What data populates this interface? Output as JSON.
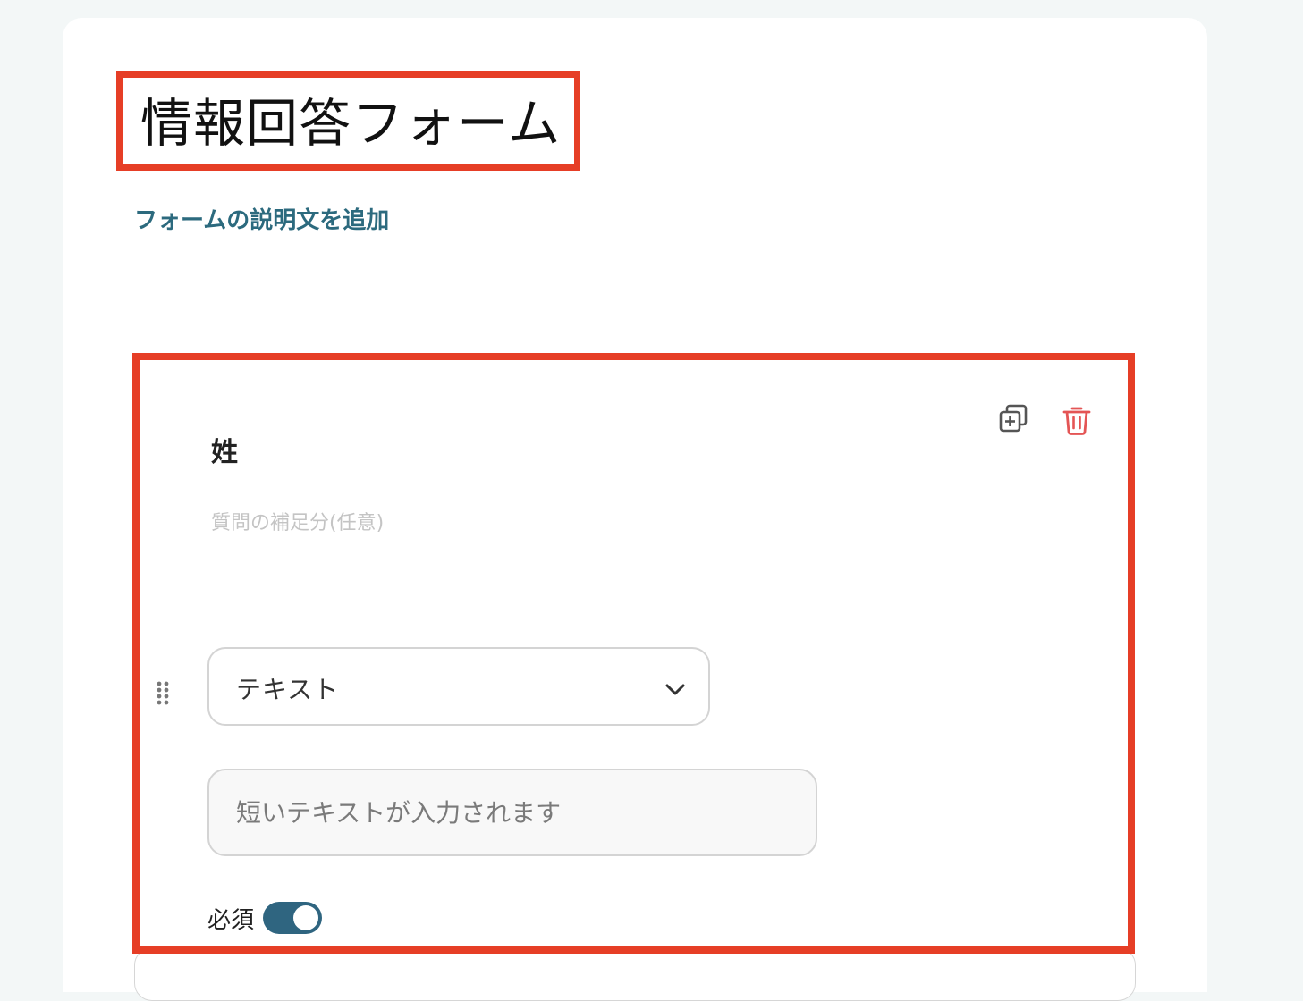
{
  "form": {
    "title": "情報回答フォーム",
    "add_description_link": "フォームの説明文を追加"
  },
  "question": {
    "title": "姓",
    "help_text": "質問の補足分(任意)",
    "type_select": {
      "selected": "テキスト"
    },
    "answer_placeholder": "短いテキストが入力されます",
    "required": {
      "label": "必須",
      "enabled": true
    },
    "icons": {
      "copy": "copy-plus-icon",
      "delete": "trash-icon",
      "drag": "drag-handle-icon",
      "dropdown": "chevron-down-icon"
    }
  },
  "colors": {
    "highlight": "#e63e26",
    "link": "#2c6a7e",
    "toggle_on": "#2f6580",
    "delete": "#e45555"
  }
}
